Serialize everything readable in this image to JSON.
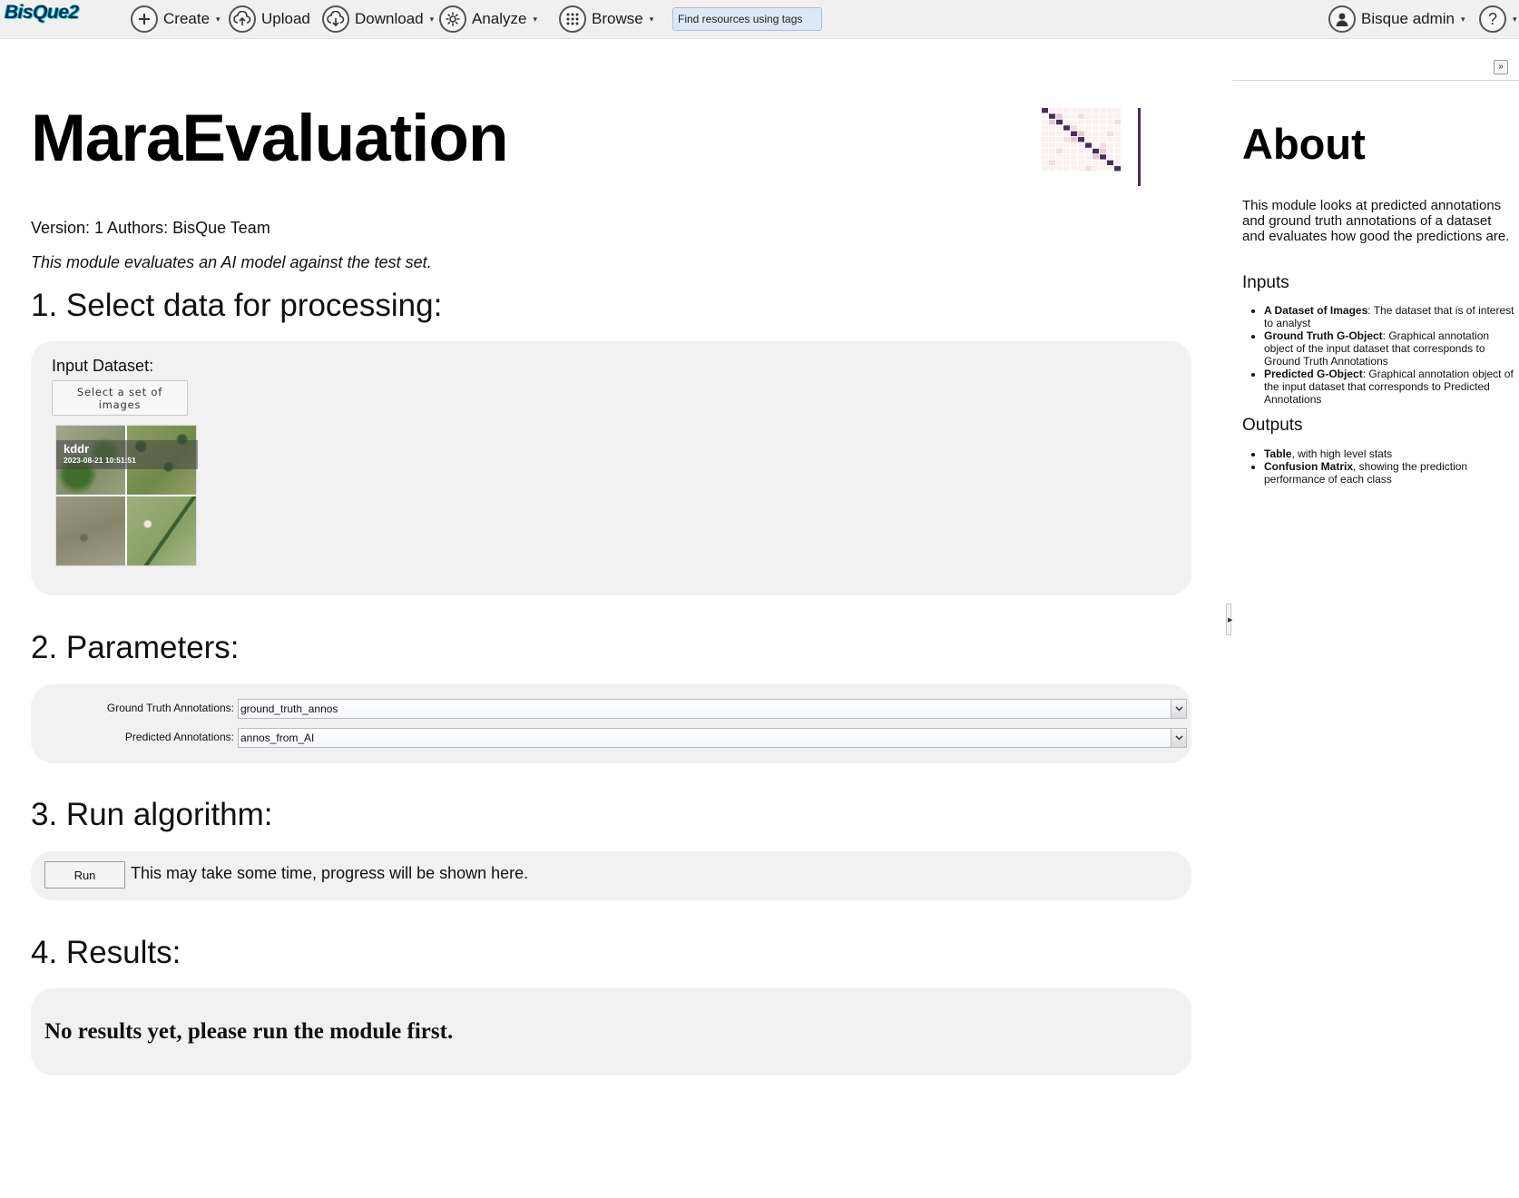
{
  "nav": {
    "logo": "BisQue2",
    "create": "Create",
    "upload": "Upload",
    "download": "Download",
    "analyze": "Analyze",
    "browse": "Browse",
    "search_placeholder": "Find resources using tags",
    "user": "Bisque admin",
    "help": "?"
  },
  "module": {
    "title": "MaraEvaluation",
    "meta": "Version: 1 Authors: BisQue Team",
    "description": "This module evaluates an AI model against the test set."
  },
  "sections": {
    "select_data": {
      "heading": "1. Select data for processing:",
      "input_label": "Input Dataset:",
      "select_button": "Select a set of images",
      "dataset": {
        "name": "kddr",
        "date": "2023-08-21 10:51:51"
      }
    },
    "parameters": {
      "heading": "2. Parameters:",
      "ground_truth_label": "Ground Truth Annotations:",
      "ground_truth_value": "ground_truth_annos",
      "predicted_label": "Predicted Annotations:",
      "predicted_value": "annos_from_AI"
    },
    "run": {
      "heading": "3. Run algorithm:",
      "button": "Run",
      "hint": "This may take some time, progress will be shown here."
    },
    "results": {
      "heading": "4. Results:",
      "empty": "No results yet, please run the module first."
    }
  },
  "about": {
    "heading": "About",
    "text": "This module looks at predicted annotations and ground truth annotations of a dataset and evaluates how good the predictions are.",
    "inputs_heading": "Inputs",
    "inputs": [
      {
        "name": "A Dataset of Images",
        "desc": ": The dataset that is of interest to analyst"
      },
      {
        "name": "Ground Truth G-Object",
        "desc": ": Graphical annotation object of the input dataset that corresponds to Ground Truth Annotations"
      },
      {
        "name": "Predicted G-Object",
        "desc": ": Graphical annotation object of the input dataset that corresponds to Predicted Annotations"
      }
    ],
    "outputs_heading": "Outputs",
    "outputs": [
      {
        "name": "Table",
        "desc": ", with high level stats"
      },
      {
        "name": "Confusion Matrix",
        "desc": ", showing the prediction performance of each class"
      }
    ]
  },
  "icons": {
    "create": "plus-circle-icon",
    "upload": "cloud-upload-icon",
    "download": "cloud-download-icon",
    "analyze": "gear-icon",
    "browse": "grid-icon",
    "user": "user-avatar-icon",
    "help": "help-icon"
  },
  "colors": {
    "topbar": "#f0f0f0",
    "panel": "#f1f1f1",
    "search_bg": "#dde8f6",
    "matrix_dark": "#4a2d5a"
  }
}
